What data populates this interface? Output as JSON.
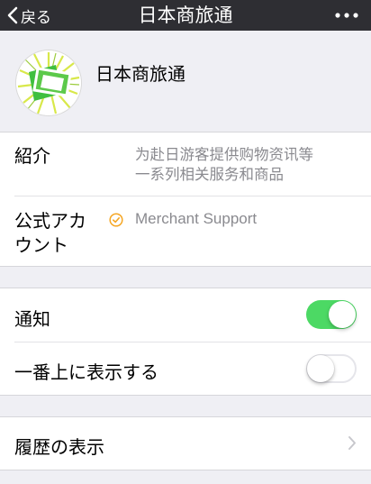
{
  "nav": {
    "back_label": "戻る",
    "title": "日本商旅通",
    "more_icon": "more-dots-icon",
    "back_icon": "chevron-left-icon",
    "bar_color": "#2e2e33"
  },
  "profile": {
    "name": "日本商旅通",
    "avatar_icon": "app-logo-avatar"
  },
  "info": {
    "intro_label": "紹介",
    "intro_line1": "为赴日游客提供购物资讯等",
    "intro_line2": "一系列相关服务和商品",
    "account_label_line1": "公式アカ",
    "account_label_line2": "ウント",
    "account_value": "Merchant Support",
    "account_badge_icon": "verified-badge-icon",
    "badge_color": "#f5a623"
  },
  "settings": {
    "notify_label": "通知",
    "notify_on": true,
    "top_label": "一番上に表示する",
    "top_on": false,
    "switch_on_color": "#4cd964"
  },
  "history": {
    "label": "履歴の表示",
    "chevron_icon": "chevron-right-icon"
  }
}
